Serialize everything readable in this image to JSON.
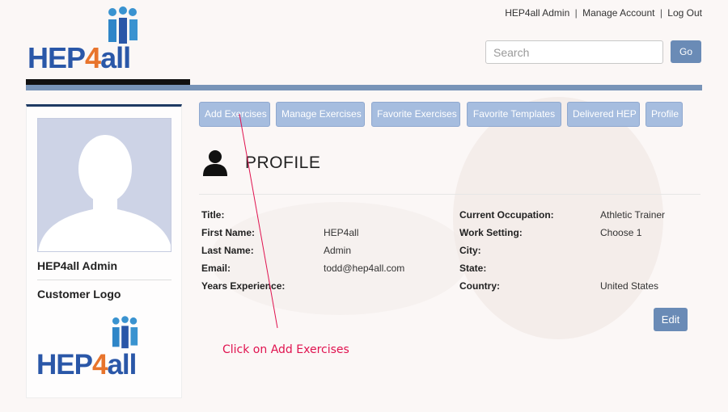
{
  "brand": {
    "logo_part1": "HEP",
    "logo_part2": "4",
    "logo_part3": "all"
  },
  "header": {
    "user_link": "HEP4all Admin",
    "manage_account": "Manage Account",
    "logout": "Log Out",
    "separator": "|"
  },
  "search": {
    "placeholder": "Search",
    "value": "",
    "go_label": "Go"
  },
  "sidebar": {
    "name": "HEP4all Admin",
    "customer_logo_label": "Customer Logo"
  },
  "nav": {
    "items": [
      "Add Exercises",
      "Manage Exercises",
      "Favorite Exercises",
      "Favorite Templates",
      "Delivered HEP",
      "Profile"
    ]
  },
  "profile": {
    "title": "PROFILE",
    "left_fields": [
      {
        "label": "Title:",
        "value": ""
      },
      {
        "label": "First Name:",
        "value": "HEP4all"
      },
      {
        "label": "Last Name:",
        "value": "Admin"
      },
      {
        "label": "Email:",
        "value": "todd@hep4all.com"
      },
      {
        "label": "Years Experience:",
        "value": ""
      }
    ],
    "right_fields": [
      {
        "label": "Current Occupation:",
        "value": "Athletic Trainer"
      },
      {
        "label": "Work Setting:",
        "value": "Choose 1"
      },
      {
        "label": "City:",
        "value": ""
      },
      {
        "label": "State:",
        "value": ""
      },
      {
        "label": "Country:",
        "value": "United States"
      }
    ],
    "edit_label": "Edit"
  },
  "annotation": {
    "text": "Click on Add Exercises",
    "color": "#e0124f"
  },
  "colors": {
    "accent": "#6a8bb6",
    "nav_button": "#a6bddf",
    "logo_blue": "#2a57a8",
    "logo_orange": "#e8742c"
  }
}
